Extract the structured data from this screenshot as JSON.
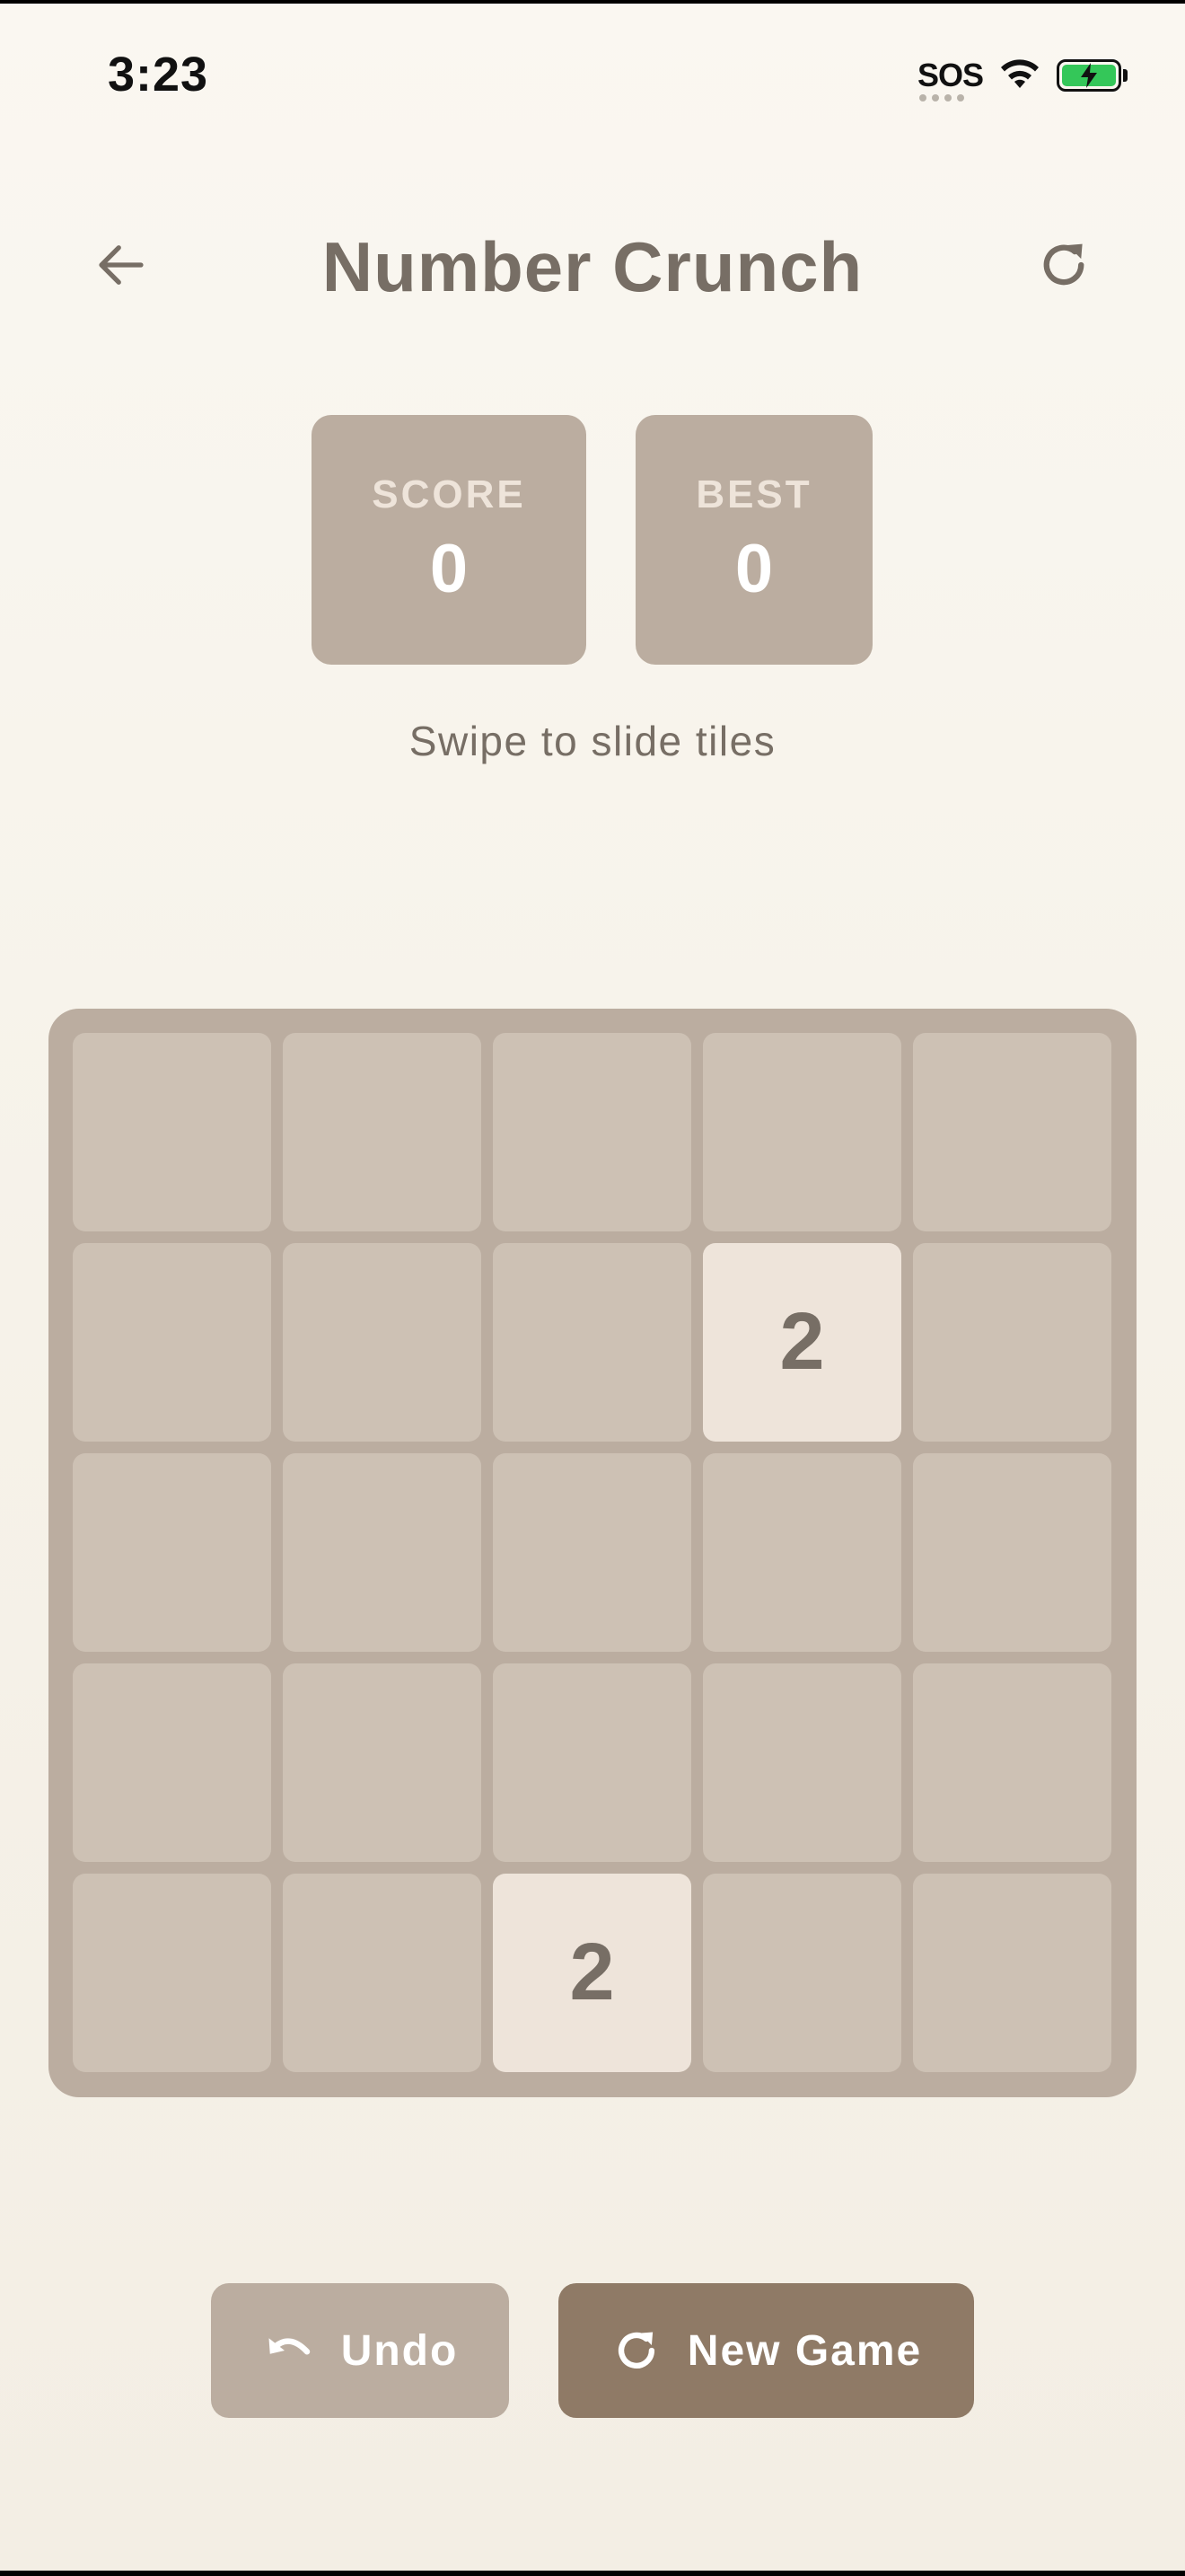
{
  "status_bar": {
    "time": "3:23",
    "sos": "SOS"
  },
  "header": {
    "title": "Number Crunch"
  },
  "scores": {
    "score_label": "SCORE",
    "score_value": "0",
    "best_label": "BEST",
    "best_value": "0"
  },
  "hint": "Swipe to slide tiles",
  "board": {
    "size": 5,
    "tiles": [
      [
        "",
        "",
        "",
        "",
        ""
      ],
      [
        "",
        "",
        "",
        "2",
        ""
      ],
      [
        "",
        "",
        "",
        "",
        ""
      ],
      [
        "",
        "",
        "",
        "",
        ""
      ],
      [
        "",
        "",
        "2",
        "",
        ""
      ]
    ]
  },
  "actions": {
    "undo_label": "Undo",
    "new_game_label": "New Game"
  },
  "colors": {
    "board": "#bbada0",
    "empty_cell": "#cdc1b4",
    "tile_2": "#eee4da",
    "text": "#776e65",
    "new_game_button": "#8f7a66",
    "battery": "#34c759"
  }
}
